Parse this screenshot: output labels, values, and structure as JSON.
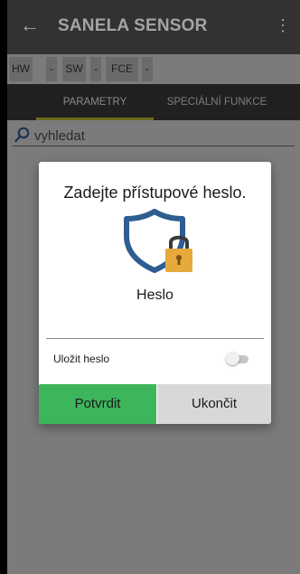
{
  "app_bar": {
    "title": "SANELA SENSOR",
    "back_icon": "arrow-left-icon",
    "menu_icon": "more-vert-icon"
  },
  "info_bar": [
    {
      "label": "HW",
      "value": "-"
    },
    {
      "label": "SW",
      "value": "-"
    },
    {
      "label": "FCE",
      "value": "-"
    }
  ],
  "tabs": [
    {
      "label": "PARAMETRY",
      "active": true
    },
    {
      "label": "SPECIÁLNÍ FUNKCE",
      "active": false
    }
  ],
  "search": {
    "placeholder": "vyhledat",
    "icon": "search-icon"
  },
  "dialog": {
    "heading": "Zadejte přístupové heslo.",
    "password_label": "Heslo",
    "password_value": "",
    "save_password_label": "Uložit heslo",
    "save_password_on": false,
    "confirm_label": "Potvrdit",
    "cancel_label": "Ukončit",
    "icon": "shield-lock-icon"
  },
  "colors": {
    "accent_green": "#3db55a",
    "shield_blue": "#2d5d91",
    "lock_orange": "#e6a93c",
    "tab_indicator": "#6d6b1e"
  }
}
